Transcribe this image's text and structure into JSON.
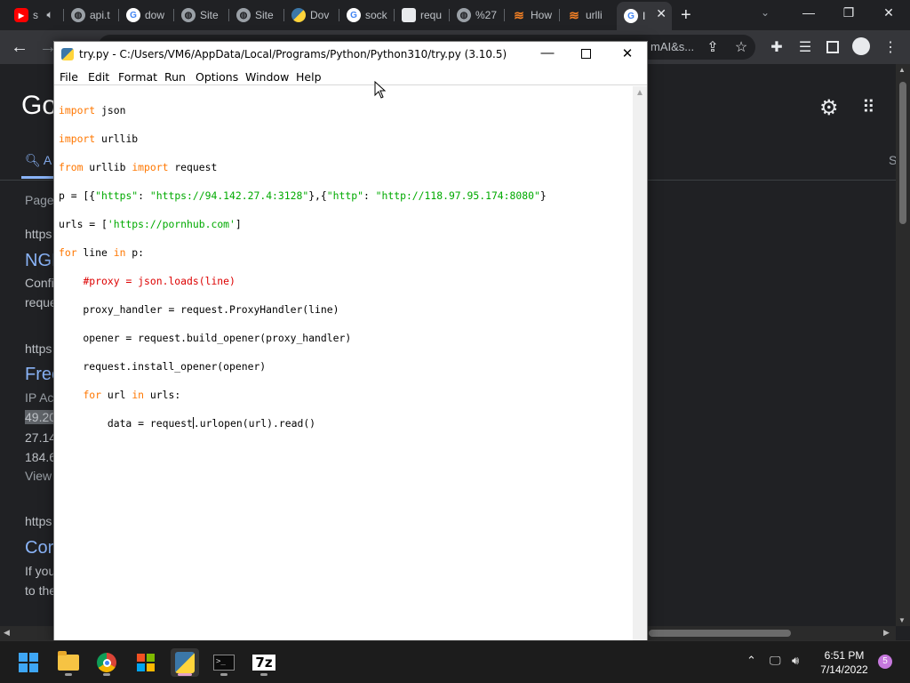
{
  "browser": {
    "tabs": [
      {
        "label": "s",
        "icon": "youtube-icon"
      },
      {
        "label": "api.t",
        "icon": "globe-icon"
      },
      {
        "label": "dow",
        "icon": "google-icon"
      },
      {
        "label": "Site",
        "icon": "globe-icon"
      },
      {
        "label": "Site",
        "icon": "globe-icon"
      },
      {
        "label": "Dov",
        "icon": "python-icon"
      },
      {
        "label": "sock",
        "icon": "google-icon"
      },
      {
        "label": "requ",
        "icon": "cube-icon"
      },
      {
        "label": "%27",
        "icon": "globe-icon"
      },
      {
        "label": "How",
        "icon": "stackoverflow-icon"
      },
      {
        "label": "urlli",
        "icon": "stackoverflow-icon"
      },
      {
        "label": "I",
        "icon": "google-icon"
      }
    ],
    "omnibox_tail": "mAI&s...",
    "page": {
      "logo": "Go",
      "all_tab": "A",
      "s_tab": "S",
      "results": [
        {
          "text": "Page",
          "kind": "gray"
        },
        {
          "text": "https",
          "kind": "url"
        },
        {
          "text": "NGI",
          "kind": "title"
        },
        {
          "text": "Confi",
          "kind": "snip"
        },
        {
          "text": "reque",
          "kind": "snip"
        },
        {
          "text": "https",
          "kind": "url"
        },
        {
          "text": "Free",
          "kind": "title"
        },
        {
          "text": "IP Ac",
          "kind": "gray"
        },
        {
          "text": "49.20",
          "kind": "hl"
        },
        {
          "text": "27.14",
          "kind": "snip"
        },
        {
          "text": "184.6",
          "kind": "snip"
        },
        {
          "text": "View",
          "kind": "gray"
        },
        {
          "text": "https",
          "kind": "url"
        },
        {
          "text": "Cor",
          "kind": "title"
        },
        {
          "text": "If you",
          "kind": "snip"
        },
        {
          "text": "to the",
          "kind": "snip"
        }
      ]
    }
  },
  "idle": {
    "title": "try.py - C:/Users/VM6/AppData/Local/Programs/Python/Python310/try.py (3.10.5)",
    "menu": [
      "File",
      "Edit",
      "Format",
      "Run",
      "Options",
      "Window",
      "Help"
    ]
  },
  "taskbar": {
    "time": "6:51 PM",
    "date": "7/14/2022",
    "notifications": "5"
  }
}
